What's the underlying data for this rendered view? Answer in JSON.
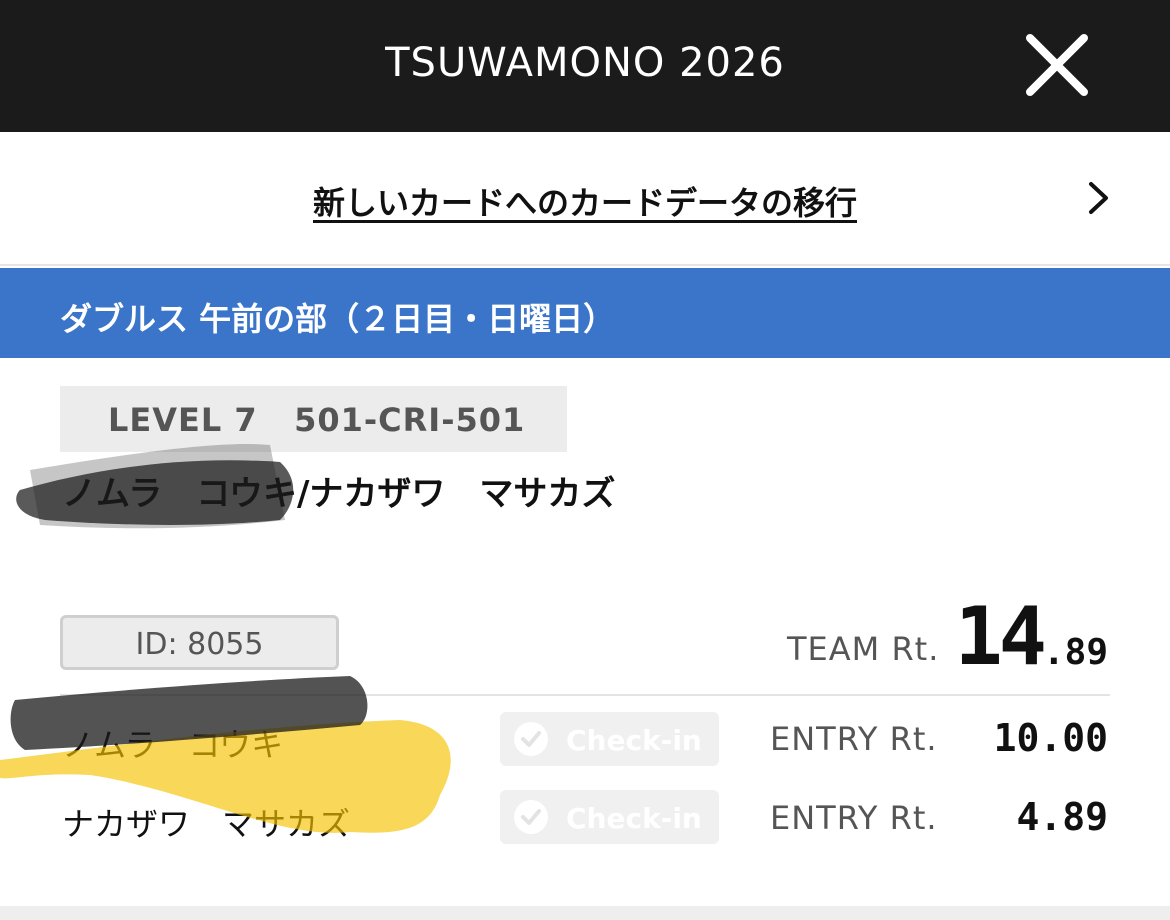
{
  "header": {
    "title": "TSUWAMONO 2026",
    "close_icon": "close-icon"
  },
  "migrate": {
    "label": "新しいカードへのカードデータの移行",
    "chevron_icon": "chevron-right-icon"
  },
  "section": {
    "title": "ダブルス 午前の部（２日目・日曜日）",
    "color": "#3a75c9"
  },
  "team": {
    "level": "LEVEL 7   501-CRI-501",
    "name": "ノムラ　コウキ/ナカザワ　マサカズ",
    "id": "ID: 8055",
    "rating_label": "TEAM Rt.",
    "rating_int": "14",
    "rating_dec": ".89"
  },
  "players": [
    {
      "name": "ノムラ　コウキ",
      "checkin_label": "Check-in",
      "entry_label": "ENTRY Rt.",
      "entry_value": "10.00"
    },
    {
      "name": "ナカザワ　マサカズ",
      "checkin_label": "Check-in",
      "entry_label": "ENTRY Rt.",
      "entry_value": "4.89"
    }
  ]
}
